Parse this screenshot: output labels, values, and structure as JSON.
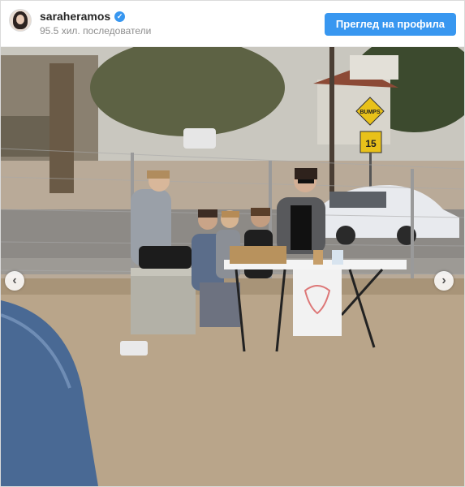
{
  "post": {
    "username": "saraheramos",
    "verified": true,
    "followers_text": "95.5 хил. последователи",
    "profile_button_label": "Преглед на профила"
  },
  "photo": {
    "sign_bumps": "BUMPS",
    "sign_speed": "15"
  },
  "icons": {
    "verified": "verified-check-icon",
    "prev": "chevron-left-icon",
    "next": "chevron-right-icon"
  },
  "colors": {
    "accent": "#3897f0",
    "username": "#262626",
    "muted": "#8e8e8e"
  },
  "nav": {
    "prev_glyph": "‹",
    "next_glyph": "›"
  }
}
